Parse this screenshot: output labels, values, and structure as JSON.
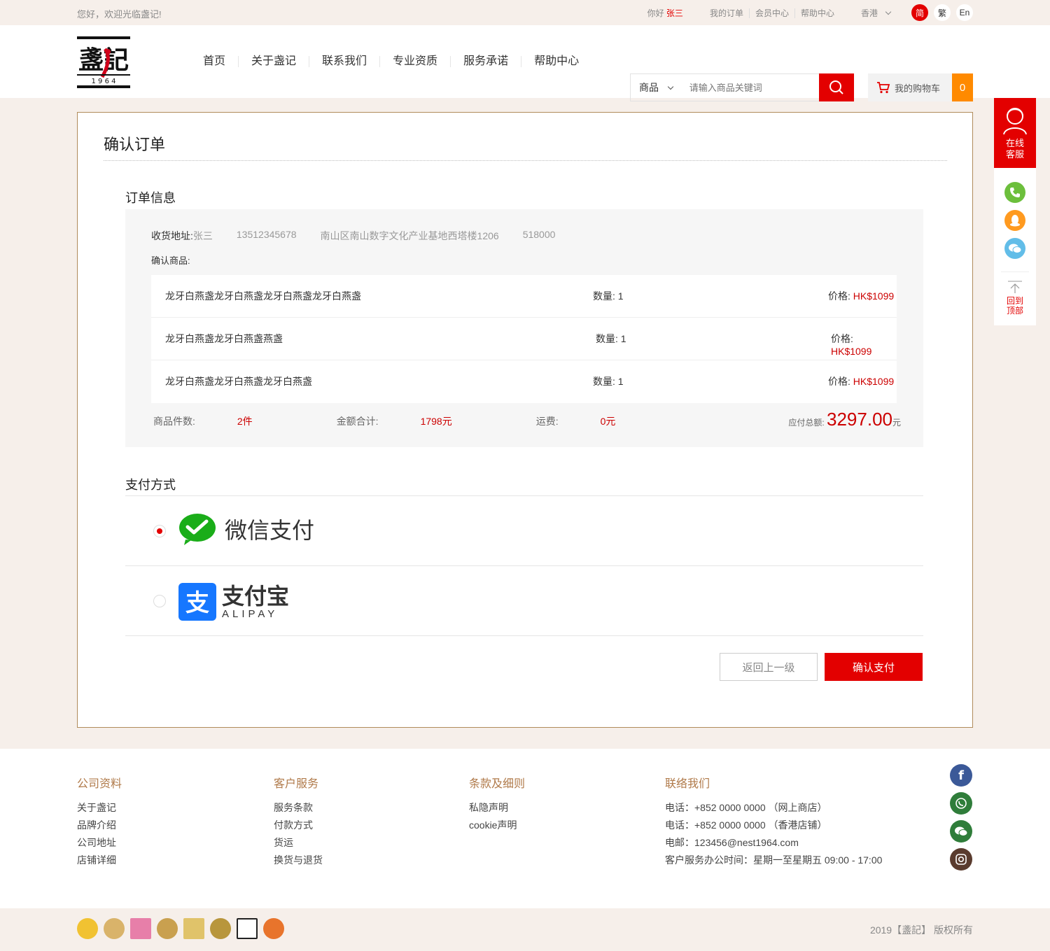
{
  "topbar": {
    "welcome": "您好，欢迎光临盏记!",
    "hello": "你好",
    "user": "张三",
    "links": [
      "我的订单",
      "会员中心",
      "帮助中心"
    ],
    "region": "香港",
    "langs": [
      "简",
      "繁",
      "En"
    ]
  },
  "header": {
    "logo_text": "盞記",
    "logo_year": "1 9 6 4",
    "nav": [
      "首页",
      "关于盏记",
      "联系我们",
      "专业资质",
      "服务承诺",
      "帮助中心"
    ],
    "search_category": "商品",
    "search_placeholder": "请输入商品关键词",
    "cart_label": "我的购物车",
    "cart_count": "0"
  },
  "main": {
    "title": "确认订单",
    "order_info_title": "订单信息",
    "address_label": "收货地址:",
    "address_name": "张三",
    "address_phone": "13512345678",
    "address_detail": "南山区南山数字文化产业基地西塔楼1206",
    "address_zip": "518000",
    "goods_label": "确认商品:",
    "goods": [
      {
        "name": "龙牙白燕盏龙牙白燕盏龙牙白燕盏龙牙白燕盏",
        "qty_label": "数量:",
        "qty": "1",
        "price_label": "价格:",
        "price": "HK$1099"
      },
      {
        "name": "龙牙白燕盏龙牙白燕盏燕盏",
        "qty_label": "数量:",
        "qty": "1",
        "price_label": "价格:",
        "price": "HK$1099"
      },
      {
        "name": "龙牙白燕盏龙牙白燕盏龙牙白燕盏",
        "qty_label": "数量:",
        "qty": "1",
        "price_label": "价格:",
        "price": "HK$1099"
      }
    ],
    "count_label": "商品件数:",
    "count_value": "2件",
    "sum_label": "金额合计:",
    "sum_value": "1798元",
    "ship_label": "运费:",
    "ship_value": "0元",
    "total_label": "应付总额:",
    "total_value": "3297.00",
    "total_unit": "元",
    "pay_title": "支付方式",
    "wechat_label": "微信支付",
    "alipay_cn": "支付宝",
    "alipay_en": "ALIPAY",
    "back_button": "返回上一级",
    "pay_button": "确认支付"
  },
  "side": {
    "service": "在线客服",
    "back_top": "回到顶部"
  },
  "footer": {
    "cols": [
      {
        "title": "公司资料",
        "links": [
          "关于盏记",
          "品牌介绍",
          "公司地址",
          "店铺详细"
        ]
      },
      {
        "title": "客户服务",
        "links": [
          "服务条款",
          "付款方式",
          "货运",
          "换货与退货"
        ]
      },
      {
        "title": "条款及细则",
        "links": [
          "私隐声明",
          "cookie声明"
        ]
      },
      {
        "title": "联络我们",
        "links": [
          "电话：+852 0000 0000 （网上商店）",
          "电话：+852 0000 0000 （香港店铺）",
          "电邮：123456@nest1964.com",
          "客户服务办公时间：星期一至星期五 09:00 - 17:00"
        ]
      }
    ],
    "copyright": "2019【盞記】 版权所有"
  },
  "colors": {
    "accent": "#e30000",
    "cart_count_bg": "#ff8a00",
    "gold": "#b08b5a"
  }
}
